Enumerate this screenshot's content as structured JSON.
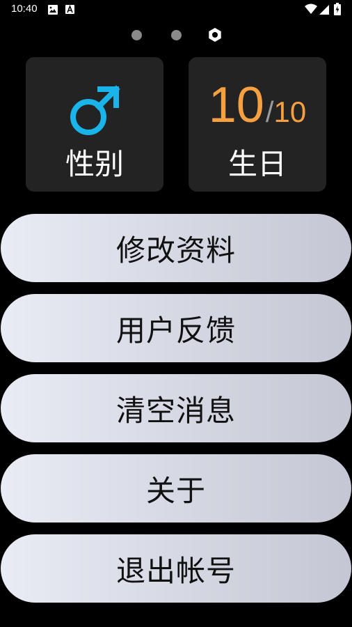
{
  "status_bar": {
    "time": "10:40",
    "left_icons": [
      "image-icon",
      "text-icon"
    ],
    "right_icons": [
      "wifi-icon",
      "signal-icon",
      "battery-icon"
    ]
  },
  "page_indicator": {
    "total": 3,
    "active_index": 2
  },
  "cards": {
    "gender": {
      "label": "性别",
      "icon": "male-symbol-icon",
      "icon_color": "#1ab4ea"
    },
    "birthday": {
      "label": "生日",
      "day": "10",
      "separator": "/",
      "month": "10",
      "value_color": "#f6a041"
    }
  },
  "menu": {
    "edit_profile": "修改资料",
    "feedback": "用户反馈",
    "clear_messages": "清空消息",
    "about": "关于",
    "logout": "退出帐号"
  },
  "colors": {
    "background": "#000000",
    "card_background": "#232323",
    "accent_orange": "#f6a041",
    "accent_blue": "#1ab4ea"
  }
}
